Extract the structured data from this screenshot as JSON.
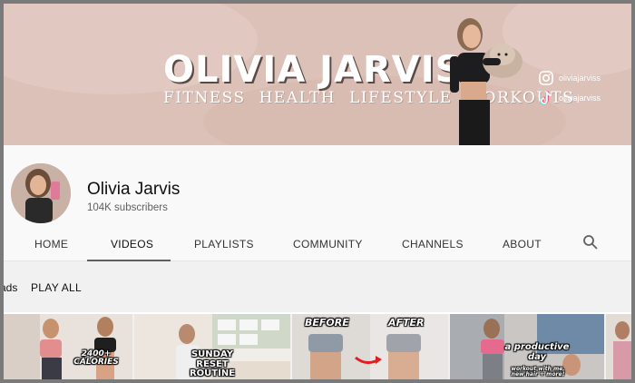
{
  "banner": {
    "title": "OLIVIA JARVIS",
    "tagline": "FITNESS  HEALTH  LIFESTYLE  WORKOUTS",
    "instagram_handle": "oliviajarviss",
    "tiktok_handle": "oliviajarviss"
  },
  "channel": {
    "name": "Olivia Jarvis",
    "subscribers": "104K subscribers"
  },
  "tabs": [
    {
      "label": "HOME"
    },
    {
      "label": "VIDEOS"
    },
    {
      "label": "PLAYLISTS"
    },
    {
      "label": "COMMUNITY"
    },
    {
      "label": "CHANNELS"
    },
    {
      "label": "ABOUT"
    }
  ],
  "active_tab": "VIDEOS",
  "section": {
    "title_fragment": "ads",
    "play_all": "PLAY ALL"
  },
  "thumbnails": [
    {
      "overlay": "2400+ CALORIES"
    },
    {
      "overlay": "SUNDAY RESET ROUTINE"
    },
    {
      "overlay_before": "BEFORE",
      "overlay_after": "AFTER"
    },
    {
      "overlay": "a productive day",
      "overlay_sub": "workout with me, new hair + more!"
    },
    {
      "overlay": ""
    }
  ],
  "colors": {
    "banner_bg": "#dcc1b8",
    "header_bg": "#f9f9f9",
    "tab_underline": "#606060"
  }
}
